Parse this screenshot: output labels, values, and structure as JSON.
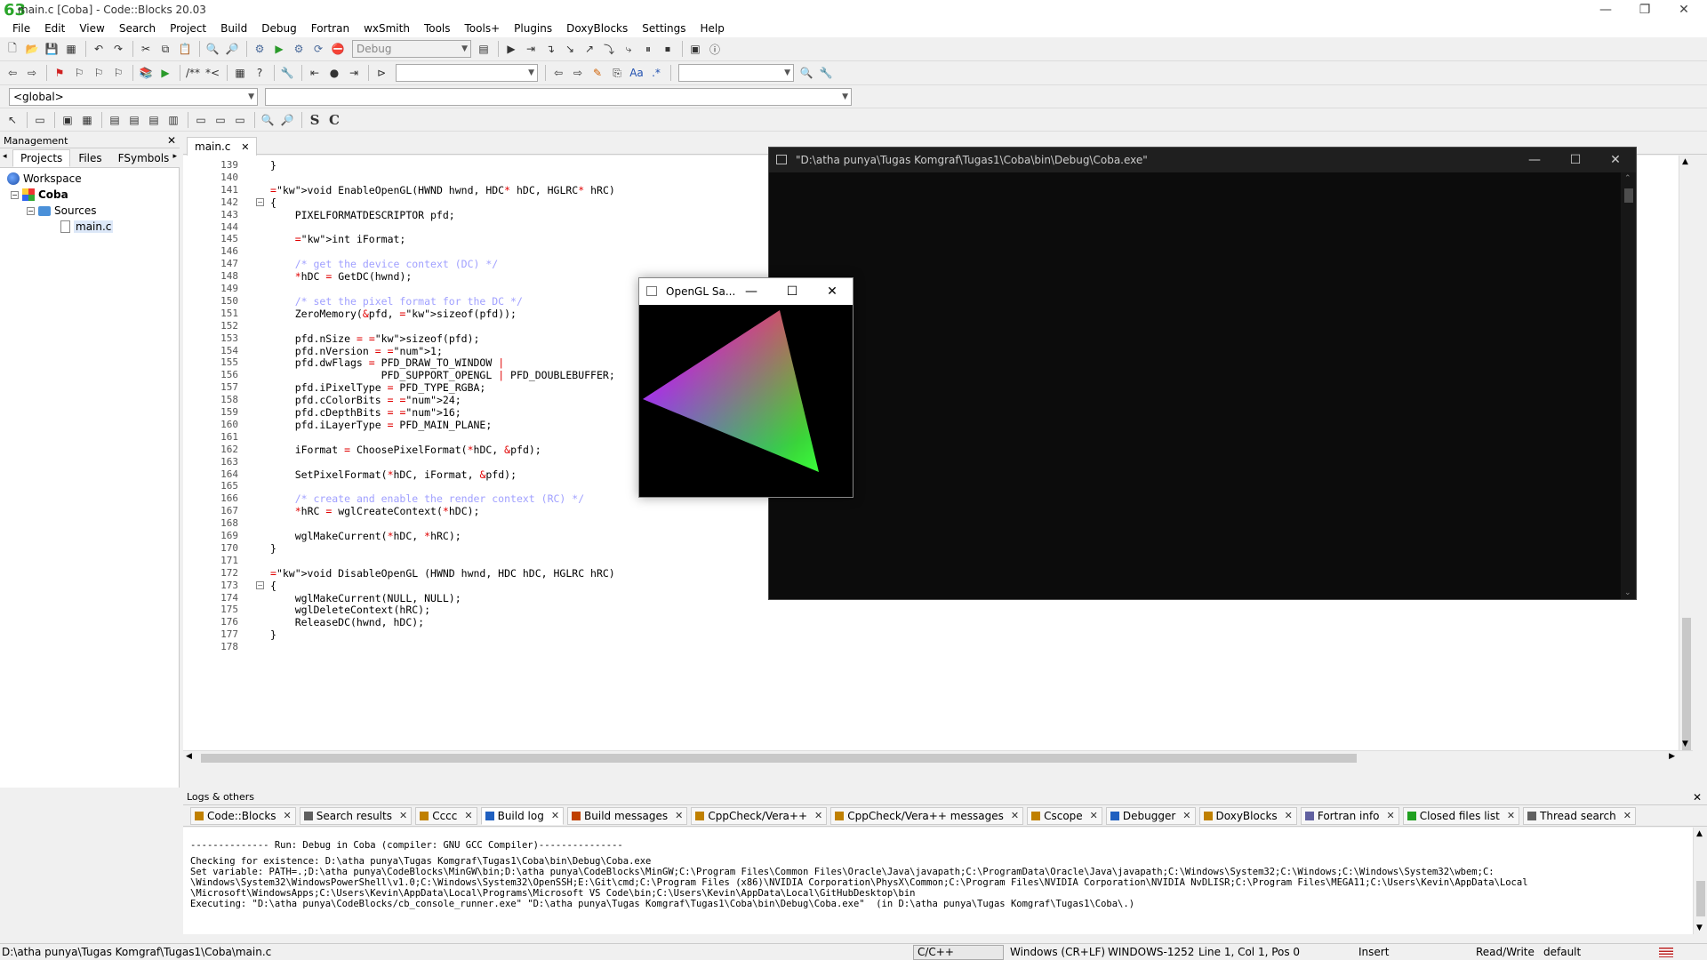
{
  "window": {
    "logo": "63",
    "title": "main.c [Coba] - Code::Blocks 20.03",
    "minimize": "—",
    "restore": "❐",
    "close": "✕"
  },
  "menu": [
    "File",
    "Edit",
    "View",
    "Search",
    "Project",
    "Build",
    "Debug",
    "Fortran",
    "wxSmith",
    "Tools",
    "Tools+",
    "Plugins",
    "DoxyBlocks",
    "Settings",
    "Help"
  ],
  "toolbar": {
    "build_target": "Debug",
    "scope_value": "<global>",
    "symbol_value": "",
    "search_value": "",
    "find_value": "",
    "bold_s": "S",
    "bold_c": "C"
  },
  "management": {
    "header": "Management",
    "close": "✕",
    "tabs": [
      "Projects",
      "Files",
      "FSymbols"
    ],
    "tree": {
      "workspace": "Workspace",
      "project": "Coba",
      "sources": "Sources",
      "file": "main.c"
    }
  },
  "editor": {
    "tab_label": "main.c",
    "tab_close": "✕",
    "lines": [
      {
        "n": "139",
        "t": "}"
      },
      {
        "n": "140",
        "t": ""
      },
      {
        "n": "141",
        "t": "void EnableOpenGL(HWND hwnd, HDC* hDC, HGLRC* hRC)"
      },
      {
        "n": "142",
        "t": "{"
      },
      {
        "n": "143",
        "t": "    PIXELFORMATDESCRIPTOR pfd;"
      },
      {
        "n": "144",
        "t": ""
      },
      {
        "n": "145",
        "t": "    int iFormat;"
      },
      {
        "n": "146",
        "t": ""
      },
      {
        "n": "147",
        "t": "    /* get the device context (DC) */"
      },
      {
        "n": "148",
        "t": "    *hDC = GetDC(hwnd);"
      },
      {
        "n": "149",
        "t": ""
      },
      {
        "n": "150",
        "t": "    /* set the pixel format for the DC */"
      },
      {
        "n": "151",
        "t": "    ZeroMemory(&pfd, sizeof(pfd));"
      },
      {
        "n": "152",
        "t": ""
      },
      {
        "n": "153",
        "t": "    pfd.nSize = sizeof(pfd);"
      },
      {
        "n": "154",
        "t": "    pfd.nVersion = 1;"
      },
      {
        "n": "155",
        "t": "    pfd.dwFlags = PFD_DRAW_TO_WINDOW |"
      },
      {
        "n": "156",
        "t": "                  PFD_SUPPORT_OPENGL | PFD_DOUBLEBUFFER;"
      },
      {
        "n": "157",
        "t": "    pfd.iPixelType = PFD_TYPE_RGBA;"
      },
      {
        "n": "158",
        "t": "    pfd.cColorBits = 24;"
      },
      {
        "n": "159",
        "t": "    pfd.cDepthBits = 16;"
      },
      {
        "n": "160",
        "t": "    pfd.iLayerType = PFD_MAIN_PLANE;"
      },
      {
        "n": "161",
        "t": ""
      },
      {
        "n": "162",
        "t": "    iFormat = ChoosePixelFormat(*hDC, &pfd);"
      },
      {
        "n": "163",
        "t": ""
      },
      {
        "n": "164",
        "t": "    SetPixelFormat(*hDC, iFormat, &pfd);"
      },
      {
        "n": "165",
        "t": ""
      },
      {
        "n": "166",
        "t": "    /* create and enable the render context (RC) */"
      },
      {
        "n": "167",
        "t": "    *hRC = wglCreateContext(*hDC);"
      },
      {
        "n": "168",
        "t": ""
      },
      {
        "n": "169",
        "t": "    wglMakeCurrent(*hDC, *hRC);"
      },
      {
        "n": "170",
        "t": "}"
      },
      {
        "n": "171",
        "t": ""
      },
      {
        "n": "172",
        "t": "void DisableOpenGL (HWND hwnd, HDC hDC, HGLRC hRC)"
      },
      {
        "n": "173",
        "t": "{"
      },
      {
        "n": "174",
        "t": "    wglMakeCurrent(NULL, NULL);"
      },
      {
        "n": "175",
        "t": "    wglDeleteContext(hRC);"
      },
      {
        "n": "176",
        "t": "    ReleaseDC(hwnd, hDC);"
      },
      {
        "n": "177",
        "t": "}"
      },
      {
        "n": "178",
        "t": ""
      }
    ]
  },
  "console": {
    "title": "\"D:\\atha punya\\Tugas Komgraf\\Tugas1\\Coba\\bin\\Debug\\Coba.exe\"",
    "minimize": "—",
    "maximize": "☐",
    "close": "✕"
  },
  "glwindow": {
    "title": "OpenGL Sa...",
    "minimize": "—",
    "maximize": "☐",
    "close": "✕"
  },
  "logs": {
    "header": "Logs & others",
    "close": "✕",
    "tabs": [
      {
        "label": "Code::Blocks",
        "color": "#c08000"
      },
      {
        "label": "Search results",
        "color": "#606060"
      },
      {
        "label": "Cccc",
        "color": "#c08000"
      },
      {
        "label": "Build log",
        "color": "#2060c0",
        "active": true
      },
      {
        "label": "Build messages",
        "color": "#c04000"
      },
      {
        "label": "CppCheck/Vera++",
        "color": "#c08000"
      },
      {
        "label": "CppCheck/Vera++ messages",
        "color": "#c08000"
      },
      {
        "label": "Cscope",
        "color": "#c08000"
      },
      {
        "label": "Debugger",
        "color": "#2060c0"
      },
      {
        "label": "DoxyBlocks",
        "color": "#c08000"
      },
      {
        "label": "Fortran info",
        "color": "#6060a0"
      },
      {
        "label": "Closed files list",
        "color": "#20a020"
      },
      {
        "label": "Thread search",
        "color": "#606060"
      }
    ],
    "lines": [
      "-------------- Run: Debug in Coba (compiler: GNU GCC Compiler)---------------",
      "Checking for existence: D:\\atha punya\\Tugas Komgraf\\Tugas1\\Coba\\bin\\Debug\\Coba.exe",
      "Set variable: PATH=.;D:\\atha punya\\CodeBlocks\\MinGW\\bin;D:\\atha punya\\CodeBlocks\\MinGW;C:\\Program Files\\Common Files\\Oracle\\Java\\javapath;C:\\ProgramData\\Oracle\\Java\\javapath;C:\\Windows\\System32;C:\\Windows;C:\\Windows\\System32\\wbem;C:",
      "\\Windows\\System32\\WindowsPowerShell\\v1.0;C:\\Windows\\System32\\OpenSSH;E:\\Git\\cmd;C:\\Program Files (x86)\\NVIDIA Corporation\\PhysX\\Common;C:\\Program Files\\NVIDIA Corporation\\NVIDIA NvDLISR;C:\\Program Files\\MEGA11;C:\\Users\\Kevin\\AppData\\Local",
      "\\Microsoft\\WindowsApps;C:\\Users\\Kevin\\AppData\\Local\\Programs\\Microsoft VS Code\\bin;C:\\Users\\Kevin\\AppData\\Local\\GitHubDesktop\\bin",
      "Executing: \"D:\\atha punya\\CodeBlocks/cb_console_runner.exe\" \"D:\\atha punya\\Tugas Komgraf\\Tugas1\\Coba\\bin\\Debug\\Coba.exe\"  (in D:\\atha punya\\Tugas Komgraf\\Tugas1\\Coba\\.)"
    ]
  },
  "status": {
    "path": "D:\\atha punya\\Tugas Komgraf\\Tugas1\\Coba\\main.c",
    "language": "C/C++",
    "line_endings": "Windows (CR+LF)",
    "encoding": "WINDOWS-1252",
    "position": "Line 1, Col 1, Pos 0",
    "mode": "Insert",
    "access": "Read/Write",
    "profile": "default"
  }
}
